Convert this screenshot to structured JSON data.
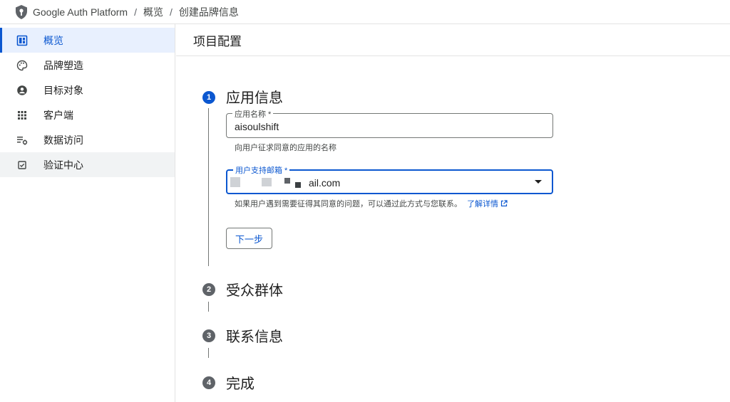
{
  "breadcrumb": {
    "app": "Google Auth Platform",
    "sep": "/",
    "overview": "概览",
    "current": "创建品牌信息"
  },
  "sidebar": {
    "items": [
      {
        "label": "概览",
        "icon": "dashboard-icon",
        "state": "active"
      },
      {
        "label": "品牌塑造",
        "icon": "palette-icon",
        "state": "normal"
      },
      {
        "label": "目标对象",
        "icon": "account-circle-icon",
        "state": "normal"
      },
      {
        "label": "客户端",
        "icon": "apps-grid-icon",
        "state": "normal"
      },
      {
        "label": "数据访问",
        "icon": "data-settings-icon",
        "state": "normal"
      },
      {
        "label": "验证中心",
        "icon": "verified-check-icon",
        "state": "hover"
      }
    ]
  },
  "main": {
    "title": "项目配置",
    "steps": [
      {
        "num": "1",
        "title": "应用信息"
      },
      {
        "num": "2",
        "title": "受众群体"
      },
      {
        "num": "3",
        "title": "联系信息"
      },
      {
        "num": "4",
        "title": "完成"
      }
    ],
    "app_name": {
      "label": "应用名称 *",
      "value": "aisoulshift",
      "hint": "向用户征求同意的应用的名称"
    },
    "support_email": {
      "label": "用户支持邮箱 *",
      "value": "ail.com",
      "hint": "如果用户遇到需要征得其同意的问题，可以通过此方式与您联系。",
      "link": "了解详情"
    },
    "next_button": "下一步"
  },
  "colors": {
    "accent": "#0b57d0",
    "active_bg": "#e8f0fe",
    "step_inactive": "#5f6368"
  }
}
